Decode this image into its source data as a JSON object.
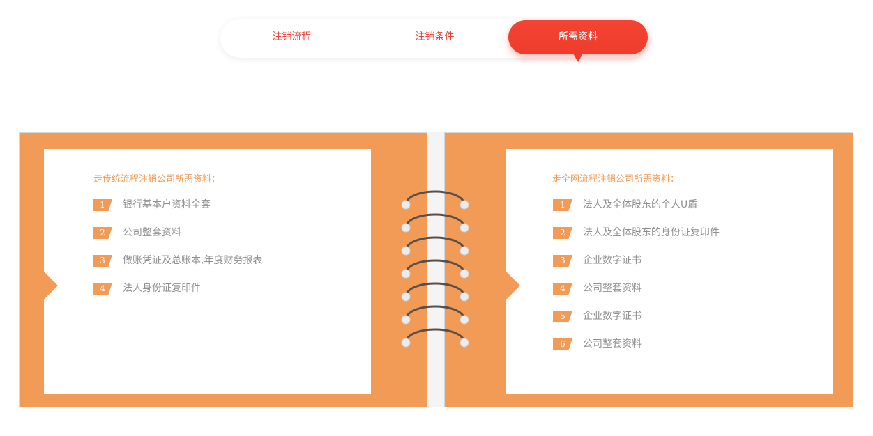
{
  "tabs": [
    {
      "label": "注销流程",
      "active": false
    },
    {
      "label": "注销条件",
      "active": false
    },
    {
      "label": "所需资料",
      "active": true
    }
  ],
  "colors": {
    "accent_red": "#ef3c2c",
    "accent_orange": "#f29b57",
    "text_gray": "#8f8f8f"
  },
  "left_panel": {
    "title": "走传统流程注销公司所需资料：",
    "items": [
      {
        "num": "1",
        "text": "银行基本户资料全套"
      },
      {
        "num": "2",
        "text": "公司整套资料"
      },
      {
        "num": "3",
        "text": "做账凭证及总账本,年度财务报表"
      },
      {
        "num": "4",
        "text": "法人身份证复印件"
      }
    ]
  },
  "right_panel": {
    "title": "走全网流程注销公司所需资料：",
    "items": [
      {
        "num": "1",
        "text": "法人及全体股东的个人U盾"
      },
      {
        "num": "2",
        "text": "法人及全体股东的身份证复印件"
      },
      {
        "num": "3",
        "text": "企业数字证书"
      },
      {
        "num": "4",
        "text": "公司整套资料"
      },
      {
        "num": "5",
        "text": "企业数字证书"
      },
      {
        "num": "6",
        "text": "公司整套资料"
      }
    ]
  }
}
